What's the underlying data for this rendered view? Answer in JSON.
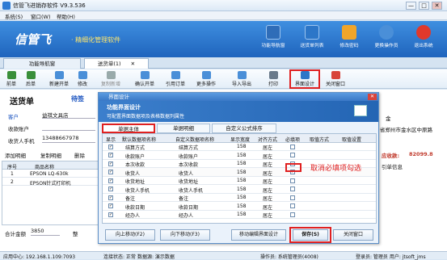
{
  "window": {
    "title": "信管飞进销存软件 V9.3.536",
    "controls": [
      "—",
      "□",
      "✕"
    ]
  },
  "menu": [
    "系统(S)",
    "窗口(W)",
    "帮助(H)"
  ],
  "banner": {
    "brand": "信管飞",
    "tagline": "· 精细化管理软件",
    "buttons": [
      {
        "label": "功能导航窗",
        "icon": "monitor-icon",
        "color": "#2f6db8"
      },
      {
        "label": "送货单列表",
        "icon": "list-icon",
        "color": "#2c76c8"
      },
      {
        "label": "修改密码",
        "icon": "lock-icon",
        "color": "#f0a52a"
      },
      {
        "label": "更换操作员",
        "icon": "user-icon",
        "color": "#4a8fd8"
      },
      {
        "label": "退出系统",
        "icon": "exit-icon",
        "color": "#e0392c"
      }
    ]
  },
  "tabs": [
    {
      "label": "功能导航窗"
    },
    {
      "label": "送货单(1)",
      "close": "✕"
    }
  ],
  "toolbar": [
    {
      "label": "前单",
      "icon": "prev-icon",
      "color": "#3a8f3a"
    },
    {
      "label": "后单",
      "icon": "next-icon",
      "color": "#3a8f3a"
    },
    {
      "label": "新建开单",
      "icon": "new-doc-icon",
      "color": "#4a8fd8"
    },
    {
      "label": "修改",
      "icon": "edit-icon",
      "color": "#4a8fd8"
    },
    {
      "label": "复制新增",
      "icon": "copy-icon",
      "color": "#9aa"
    },
    {
      "label": "确认开单",
      "icon": "confirm-icon",
      "color": "#4a8fd8"
    },
    {
      "label": "引用订单",
      "icon": "reference-icon",
      "color": "#4a8fd8"
    },
    {
      "label": "更多操作",
      "icon": "more-icon",
      "color": "#4a8fd8"
    },
    {
      "label": "导入导出",
      "icon": "import-export-icon",
      "color": "#4a8fd8"
    },
    {
      "label": "打印",
      "icon": "print-icon",
      "color": "#6a7a8a"
    },
    {
      "label": "界面设计",
      "icon": "layout-icon",
      "color": "#2c76c8"
    },
    {
      "label": "关闭窗口",
      "icon": "close-window-icon",
      "color": "#d8443a"
    }
  ],
  "document": {
    "title": "送货单",
    "status": "待签",
    "customer_label": "客户",
    "customer_value": "益祺文具店",
    "account_label": "收款账户",
    "receiver_label": "收货人手机",
    "receiver_value": "13488667978",
    "right_label": "金",
    "right_address": "省郑州市金水区中原路",
    "add_row": "添加明细",
    "copy_row": "复制明细",
    "delete_row": "删除",
    "discount_label": "应收款:",
    "discount_value": "82099.8",
    "ref_header": "引单信息",
    "grid_headers": [
      "序号",
      "商品名称"
    ],
    "grid_rows": [
      {
        "no": "1",
        "name": "EPSON LQ-630k"
      },
      {
        "no": "2",
        "name": "EPSON针式打印机"
      }
    ],
    "total_label": "合计金额",
    "total_value": "3850",
    "extra_label": "整"
  },
  "status": {
    "center": "应用中心: 192.168.1.109:7093",
    "connection": "连接状态: 正常",
    "mode": "数据源: 演示数据",
    "tip": "操作员: 系统管理员(4008)",
    "user": "登录员: 管理员 用户: jtsoft_jms"
  },
  "dialog": {
    "caption": "界面设计",
    "close": "✕",
    "head_title": "功能界面设计",
    "head_sub": "可配置界面数据项及表格数据列属性",
    "tabs": [
      "单据主体",
      "单据明细",
      "自定义公式排序"
    ],
    "columns": [
      "显示",
      "默认数据项名称",
      "自定义数据项名称",
      "显示宽度",
      "对齐方式",
      "必填项",
      "取值方式",
      "取值设置"
    ],
    "rows": [
      {
        "show": true,
        "name": "结算方式",
        "custom": "结算方式",
        "width": "158",
        "align": "居左",
        "required": false
      },
      {
        "show": true,
        "name": "收款账户",
        "custom": "收款账户",
        "width": "158",
        "align": "居左",
        "required": false
      },
      {
        "show": true,
        "name": "本次收款",
        "custom": "本次收款",
        "width": "158",
        "align": "居左",
        "required": false
      },
      {
        "show": true,
        "name": "收货人",
        "custom": "收货人",
        "width": "158",
        "align": "居左",
        "required": true
      },
      {
        "show": true,
        "name": "收货地址",
        "custom": "收货地址",
        "width": "158",
        "align": "居左",
        "required": false
      },
      {
        "show": true,
        "name": "收货人手机",
        "custom": "收货人手机",
        "width": "158",
        "align": "居左",
        "required": false
      },
      {
        "show": true,
        "name": "备注",
        "custom": "备注",
        "width": "158",
        "align": "居左",
        "required": false
      },
      {
        "show": true,
        "name": "收款日期",
        "custom": "收款日期",
        "width": "158",
        "align": "居左",
        "required": false
      },
      {
        "show": true,
        "name": "经办人",
        "custom": "经办人",
        "width": "158",
        "align": "居左",
        "required": false
      }
    ],
    "note": "取消必填项勾选",
    "buttons": {
      "up": "向上移动(F2)",
      "down": "向下移动(F3)",
      "move_field": "移动编辑界面设计",
      "save": "保存(S)",
      "close": "关闭窗口"
    }
  },
  "colors": {
    "accent": "#2c76c8",
    "highlight": "#e02020"
  }
}
